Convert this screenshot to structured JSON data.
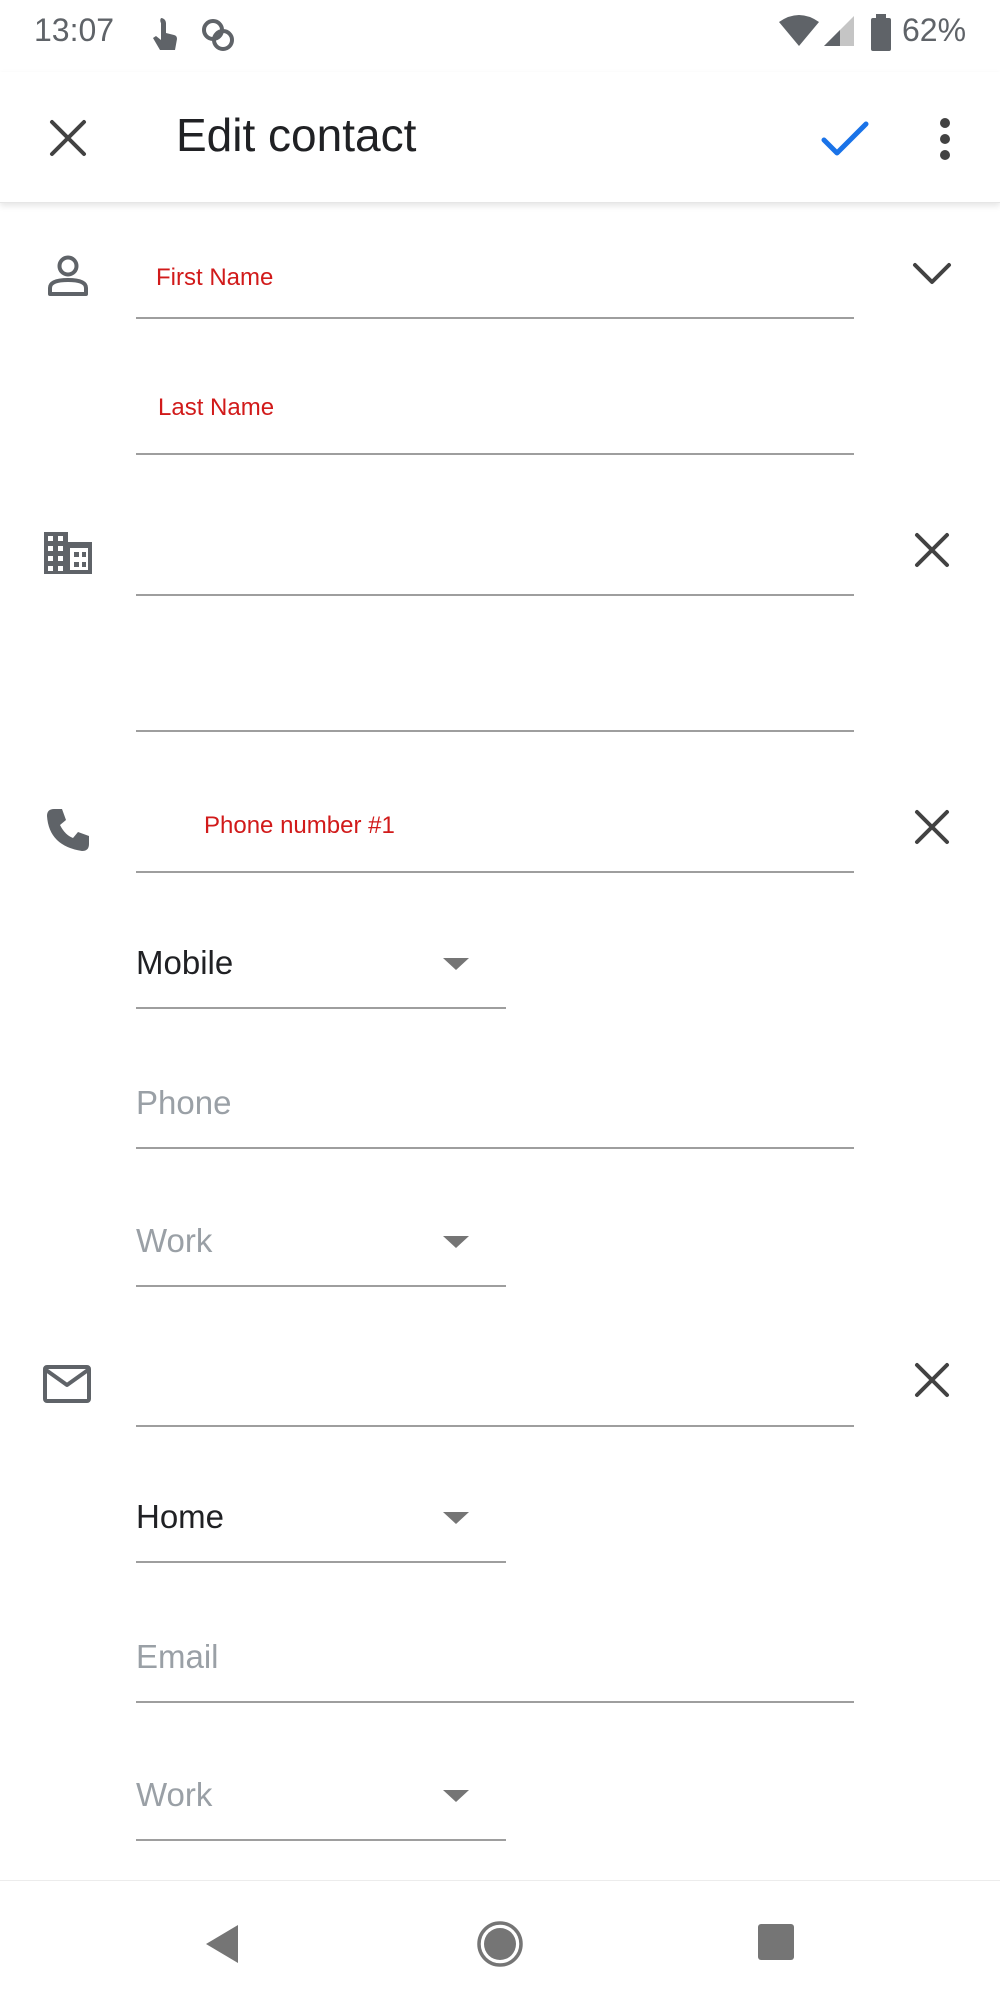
{
  "status_bar": {
    "time": "13:07",
    "battery": "62%"
  },
  "app_bar": {
    "title": "Edit contact"
  },
  "name_section": {
    "first_name_placeholder": "First Name",
    "last_name_placeholder": "Last Name"
  },
  "phone_section": {
    "label": "Phone number #1",
    "type_1": "Mobile",
    "phone_placeholder": "Phone",
    "type_2": "Work"
  },
  "email_section": {
    "type_1": "Home",
    "email_placeholder": "Email",
    "type_2": "Work"
  },
  "colors": {
    "accent": "#1a73e8",
    "icon_grey": "#5f6368",
    "label_red": "#d11a1a"
  }
}
